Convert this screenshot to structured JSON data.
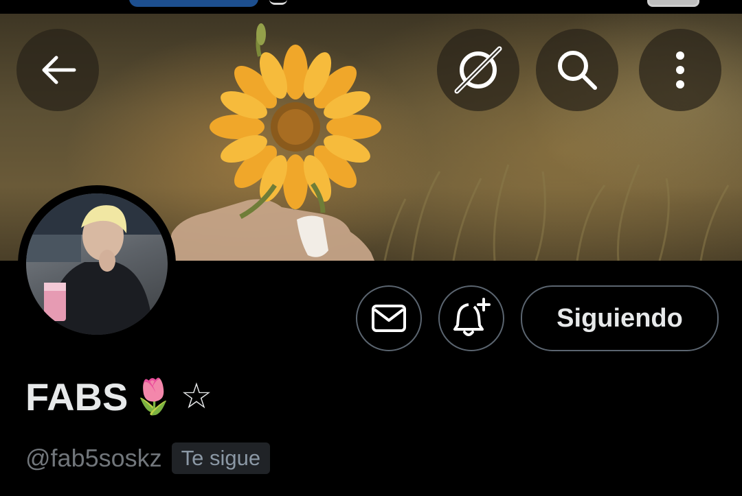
{
  "header": {
    "back_icon": "arrow-left-icon",
    "grok_icon": "grok-slash-icon",
    "search_icon": "search-icon",
    "more_icon": "more-vertical-icon"
  },
  "profile": {
    "display_name": "FABS",
    "name_emoji": "🌷",
    "name_star": "☆",
    "handle": "@fab5soskz",
    "follows_you_badge": "Te sigue"
  },
  "actions": {
    "message_icon": "envelope-icon",
    "notify_icon": "bell-plus-icon",
    "follow_state_label": "Siguiendo"
  },
  "colors": {
    "background": "#000000",
    "text_primary": "#e7e9ea",
    "text_secondary": "#71767b",
    "button_border": "#5b6570",
    "badge_background": "#202327"
  }
}
